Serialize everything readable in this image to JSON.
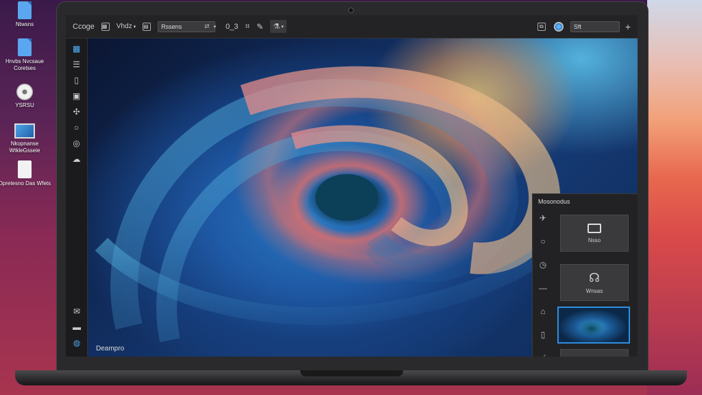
{
  "desktop": {
    "icons": [
      {
        "label": "Ntwsns",
        "glyph": "file-icon"
      },
      {
        "label": "Hnvbs Nvcsaue Coretses",
        "glyph": "file-icon"
      },
      {
        "label": "YSRSU",
        "glyph": "disc-icon"
      },
      {
        "label": "Nkopnanse WtkleGsseie",
        "glyph": "monitor-icon"
      },
      {
        "label": "Dpretesno Das Wfets",
        "glyph": "document-icon"
      }
    ]
  },
  "toolbar": {
    "app_label": "Ccoge",
    "view_label": "Vhdz",
    "search_value": "Rssens",
    "zoom_text": "0_3",
    "active_tool": "eyedropper-icon",
    "right_input_value": "Sft"
  },
  "rail": {
    "items": [
      "grid-icon",
      "sliders-icon",
      "layers-icon",
      "frame-icon",
      "adjust-icon",
      "circle-icon",
      "filter-icon",
      "cloud-icon"
    ],
    "bottom": [
      "mail-icon",
      "folder-icon",
      "globe-icon"
    ]
  },
  "canvas": {
    "label": "Deampro"
  },
  "panel": {
    "title": "Mosonodus",
    "rail": [
      "plane-icon",
      "circle-icon",
      "clock-icon",
      "minus-icon",
      "dome-icon",
      "phone-icon",
      "pen-icon"
    ],
    "thumbs": [
      {
        "label": "Nsso"
      },
      {
        "label": "Wnsas"
      },
      {
        "label": ""
      }
    ]
  },
  "colors": {
    "accent": "#2f8fe0",
    "chrome": "#232325",
    "rail": "#1b1b1d"
  }
}
